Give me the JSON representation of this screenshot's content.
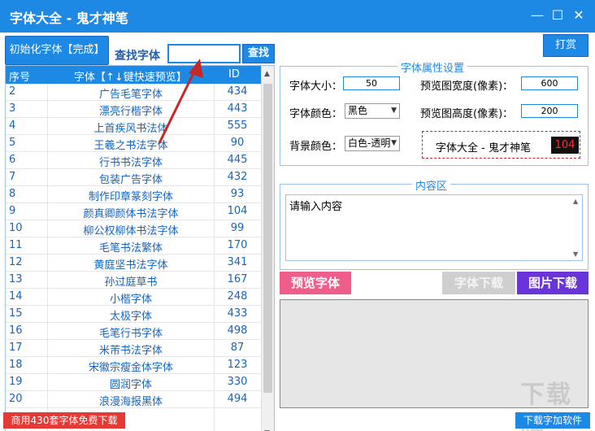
{
  "window": {
    "title": "字体大全 - 鬼才神笔",
    "minimize_icon": "minimize-icon",
    "maximize_icon": "maximize-icon",
    "close_icon": "close-icon"
  },
  "toolbar": {
    "init_label": "初始化字体【完成】",
    "search_label": "查找字体",
    "search_value": "",
    "search_button": "查找",
    "donate_button": "打赏"
  },
  "table": {
    "headers": [
      "序号",
      "字体【↑↓键快速预览】",
      "ID"
    ],
    "rows": [
      [
        "2",
        "广告毛笔字体",
        "434"
      ],
      [
        "3",
        "漂亮行楷字体",
        "443"
      ],
      [
        "4",
        "上首疾风书法体",
        "555"
      ],
      [
        "5",
        "王羲之书法字体",
        "90"
      ],
      [
        "6",
        "行书书法字体",
        "445"
      ],
      [
        "7",
        "包装广告字体",
        "432"
      ],
      [
        "8",
        "制作印章篆刻字体",
        "93"
      ],
      [
        "9",
        "颜真卿颜体书法字体",
        "104"
      ],
      [
        "10",
        "柳公权柳体书法字体",
        "99"
      ],
      [
        "11",
        "毛笔书法繁体",
        "170"
      ],
      [
        "12",
        "黄庭坚书法字体",
        "341"
      ],
      [
        "13",
        "孙过庭草书",
        "167"
      ],
      [
        "14",
        "小楷字体",
        "248"
      ],
      [
        "15",
        "太极字体",
        "433"
      ],
      [
        "16",
        "毛笔行书字体",
        "498"
      ],
      [
        "17",
        "米芾书法字体",
        "87"
      ],
      [
        "18",
        "宋徽宗瘦金体字体",
        "123"
      ],
      [
        "19",
        "圆润字体",
        "330"
      ],
      [
        "20",
        "浪漫海报黑体",
        "494"
      ]
    ]
  },
  "props": {
    "legend": "字体属性设置",
    "font_size_label": "字体大小：",
    "font_size_value": "50",
    "preview_width_label": "预览图宽度(像素)：",
    "preview_width_value": "600",
    "font_color_label": "字体颜色：",
    "font_color_value": "黑色",
    "preview_height_label": "预览图高度(像素)：",
    "preview_height_value": "200",
    "bg_color_label": "背景颜色：",
    "bg_color_value": "白色-透明",
    "preview_text": "字体大全 - 鬼才神笔",
    "preview_number": "104"
  },
  "content": {
    "legend": "内容区",
    "text": "请输入内容"
  },
  "actions": {
    "preview_font": "预览字体",
    "download_font": "字体下载",
    "download_image": "图片下载"
  },
  "footer": {
    "promo": "商用430套字体免费下载",
    "download_app": "下载字加软件",
    "watermark": "下载吧"
  },
  "colors": {
    "accent": "#1e88e5",
    "promo": "#e53935",
    "preview_btn": "#ef5d8a",
    "image_btn": "#6a35d8",
    "arrow": "#c62828"
  }
}
